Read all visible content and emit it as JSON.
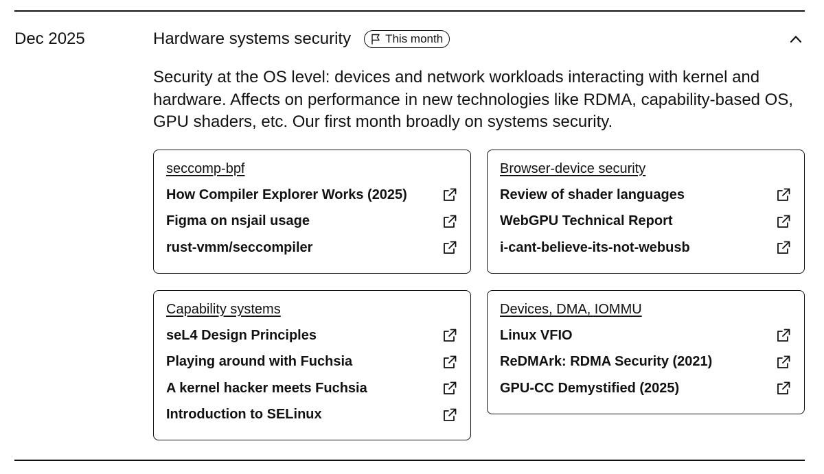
{
  "entry": {
    "date": "Dec 2025",
    "title": "Hardware systems security",
    "badge": "This month",
    "badge_icon": "flag-icon",
    "collapse_icon": "chevron-up-icon",
    "description": "Security at the OS level: devices and network workloads interacting with kernel and hardware. Affects on performance in new technologies like RDMA, capability-based OS, GPU shaders, etc. Our first month broadly on systems security.",
    "link_icon": "external-link-icon",
    "cards": [
      {
        "title": "seccomp-bpf",
        "links": [
          "How Compiler Explorer Works (2025)",
          "Figma on nsjail usage",
          "rust-vmm/seccompiler"
        ]
      },
      {
        "title": "Browser-device security",
        "links": [
          "Review of shader languages",
          "WebGPU Technical Report",
          "i-cant-believe-its-not-webusb"
        ]
      },
      {
        "title": "Capability systems",
        "links": [
          "seL4 Design Principles",
          "Playing around with Fuchsia",
          "A kernel hacker meets Fuchsia",
          "Introduction to SELinux"
        ]
      },
      {
        "title": "Devices, DMA, IOMMU",
        "links": [
          "Linux VFIO",
          "ReDMArk: RDMA Security (2021)",
          "GPU-CC Demystified (2025)"
        ]
      }
    ]
  },
  "colors": {
    "text": "#111111",
    "background": "#ffffff",
    "border": "#111111"
  }
}
